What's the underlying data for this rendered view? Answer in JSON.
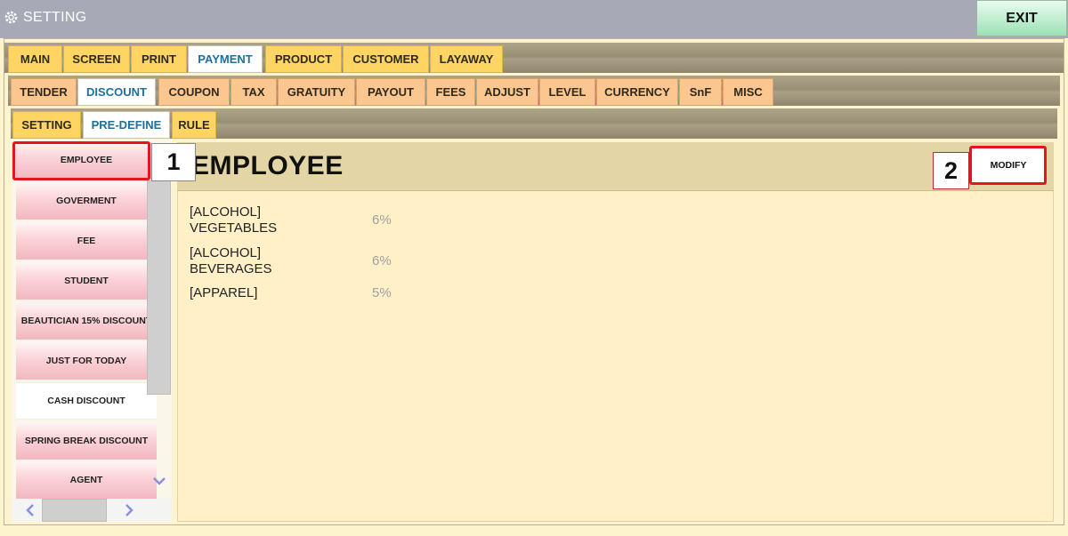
{
  "window": {
    "title": "SETTING",
    "exit_label": "EXIT"
  },
  "tabs_main": [
    "MAIN",
    "SCREEN",
    "PRINT",
    "PAYMENT",
    "PRODUCT",
    "CUSTOMER",
    "LAYAWAY"
  ],
  "tabs_payment": [
    "TENDER",
    "DISCOUNT",
    "COUPON",
    "TAX",
    "GRATUITY",
    "PAYOUT",
    "FEES",
    "ADJUST",
    "LEVEL",
    "CURRENCY",
    "SnF",
    "MISC"
  ],
  "tabs_discount": [
    "SETTING",
    "PRE-DEFINE",
    "RULE"
  ],
  "active": {
    "main": "PAYMENT",
    "payment": "DISCOUNT",
    "discount": "PRE-DEFINE"
  },
  "discount_list": [
    "EMPLOYEE",
    "GOVERMENT",
    "FEE",
    "STUDENT",
    "BEAUTICIAN 15% DISCOUNT",
    "JUST FOR TODAY",
    "CASH DISCOUNT",
    "SPRING BREAK DISCOUNT",
    "AGENT"
  ],
  "detail": {
    "title": "EMPLOYEE",
    "modify_label": "MODIFY",
    "rules": [
      {
        "line1": "[ALCOHOL]",
        "line2": "VEGETABLES",
        "percent": "6%"
      },
      {
        "line1": "[ALCOHOL]",
        "line2": "BEVERAGES",
        "percent": "6%"
      },
      {
        "line1": "[APPAREL]",
        "line2": "",
        "percent": "5%"
      }
    ]
  },
  "annotations": {
    "step1": "1",
    "step2": "2"
  },
  "colors": {
    "highlight": "#e8141b",
    "active_tab_text": "#1f6f9a",
    "exit_green": "#9be2b5"
  }
}
